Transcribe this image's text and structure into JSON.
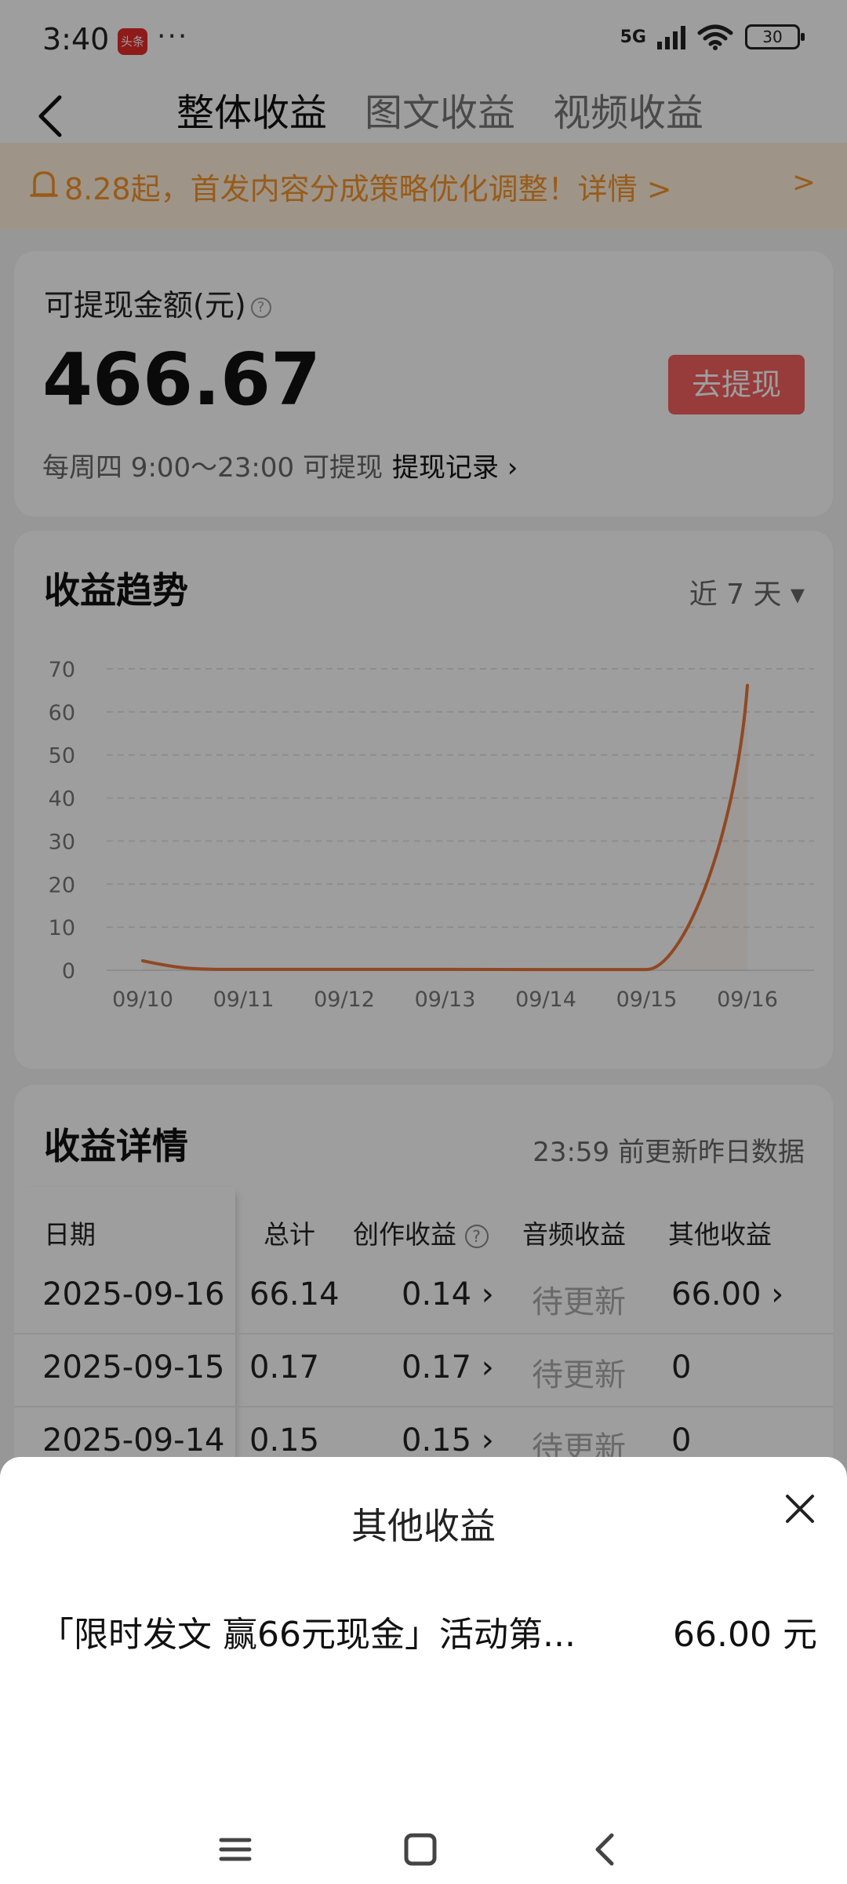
{
  "status_bar": {
    "time": "3:40",
    "app_badge": "头条",
    "dots": "···",
    "signal": "5G",
    "battery": "30"
  },
  "header": {
    "tabs": [
      {
        "label": "整体收益"
      },
      {
        "label": "图文收益"
      },
      {
        "label": "视频收益"
      }
    ]
  },
  "notice": {
    "text": "8.28起，首发内容分成策略优化调整！详情 >",
    "arrow": ">"
  },
  "withdraw": {
    "label": "可提现金额(元)",
    "help_icon": "?",
    "amount": "466.67",
    "button": "去提现",
    "schedule": "每周四 9:00～23:00 可提现",
    "record_link": "提现记录 ›"
  },
  "trend": {
    "title": "收益趋势",
    "range": "近 7 天 ▾",
    "y_ticks": [
      "70",
      "60",
      "50",
      "40",
      "30",
      "20",
      "10",
      "0"
    ],
    "x_ticks": [
      "09/10",
      "09/11",
      "09/12",
      "09/13",
      "09/14",
      "09/15",
      "09/16"
    ]
  },
  "chart_data": {
    "type": "line",
    "title": "收益趋势",
    "categories": [
      "09/10",
      "09/11",
      "09/12",
      "09/13",
      "09/14",
      "09/15",
      "09/16"
    ],
    "series": [
      {
        "values": [
          2.2,
          0.2,
          0.2,
          0.2,
          0.15,
          0.17,
          66.14
        ]
      }
    ],
    "ylim": [
      0,
      70
    ],
    "y_ticks": [
      0,
      10,
      20,
      30,
      40,
      50,
      60,
      70
    ],
    "grid": true,
    "color": "#e8753a"
  },
  "detail": {
    "title": "收益详情",
    "update_note": "23:59 前更新昨日数据",
    "columns": [
      "日期",
      "总计",
      "创作收益",
      "音频收益",
      "其他收益"
    ],
    "rows": [
      {
        "date": "2025-09-16",
        "total": "66.14",
        "creation": "0.14 ›",
        "audio": "待更新",
        "other": "66.00 ›"
      },
      {
        "date": "2025-09-15",
        "total": "0.17",
        "creation": "0.17 ›",
        "audio": "待更新",
        "other": "0"
      },
      {
        "date": "2025-09-14",
        "total": "0.15",
        "creation": "0.15 ›",
        "audio": "待更新",
        "other": "0"
      }
    ]
  },
  "sheet": {
    "title": "其他收益",
    "item_label": "「限时发文 赢66元现金」活动第...",
    "item_value": "66.00 元"
  }
}
